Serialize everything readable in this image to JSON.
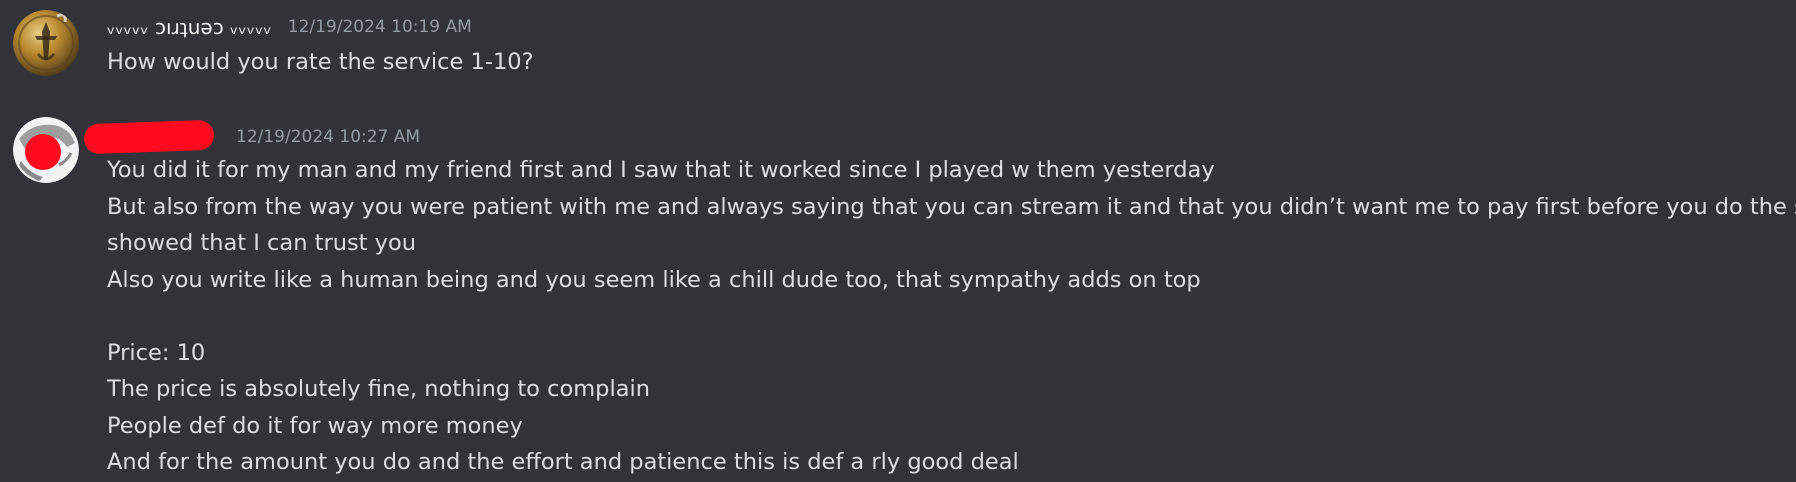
{
  "messages": [
    {
      "author": "ᵥᵥᵥᵥᵥ ɔıɹʇuǝɔ ᵥᵥᵥᵥᵥ",
      "timestamp": "12/19/2024 10:19 AM",
      "lines": [
        "How would you rate the service 1-10?"
      ],
      "avatar": {
        "icon": "medallion-avatar-icon",
        "colors": {
          "gold": "#b8892e",
          "dark": "#3a2a16",
          "light": "#e8cf86"
        }
      }
    },
    {
      "author_redacted": true,
      "timestamp": "12/19/2024 10:27 AM",
      "lines": [
        "You did it for my man and my friend first and I saw that it worked since I played w them yesterday",
        "But also from the way you were patient with me and always saying that you can stream it and that you didn’t want me to pay first before you do the stuff ,",
        "showed that I can trust you",
        "Also you write like a human being and you seem like a chill dude too, that sympathy adds on top",
        "",
        "Price: 10",
        "The price is absolutely fine, nothing to complain",
        "People def do it for way more money",
        "And for the amount you do and the effort and patience this is def a rly good deal"
      ],
      "avatar": {
        "icon": "redacted-avatar-icon",
        "colors": {
          "redaction": "#ff0a1e",
          "background": "#f2f2f2"
        }
      }
    }
  ],
  "theme": {
    "background": "#313338",
    "username": "#f2f3f5",
    "timestamp": "#949ba4",
    "text": "#dbdee1"
  }
}
